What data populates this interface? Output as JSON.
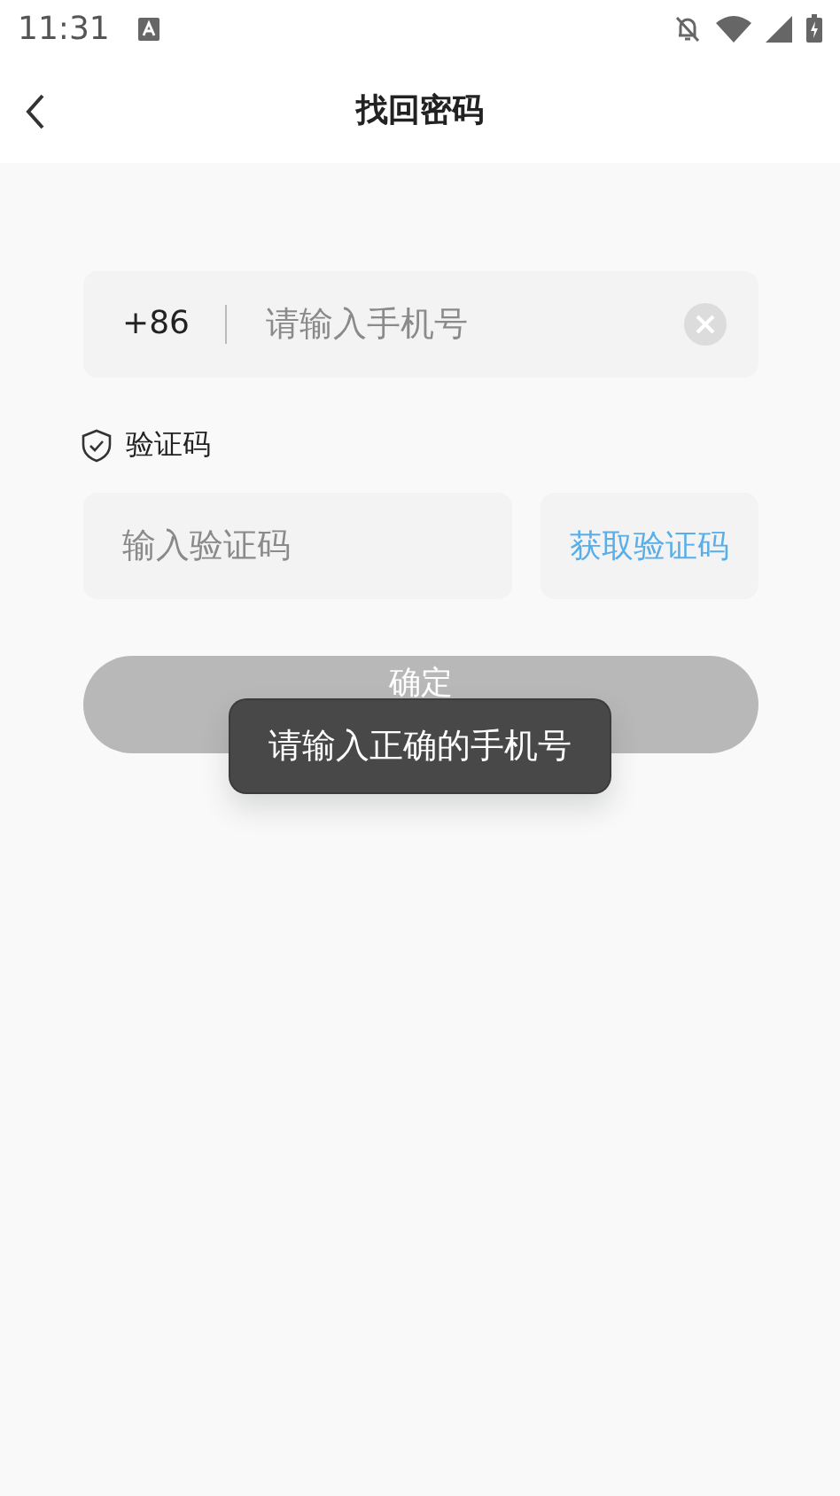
{
  "status_bar": {
    "time": "11:31"
  },
  "header": {
    "title": "找回密码"
  },
  "phone": {
    "prefix": "+86",
    "placeholder": "请输入手机号"
  },
  "code_label": "验证码",
  "code": {
    "placeholder": "输入验证码",
    "send_button": "获取验证码"
  },
  "confirm": {
    "label": "确定",
    "disabled": true
  },
  "toast": "请输入正确的手机号"
}
